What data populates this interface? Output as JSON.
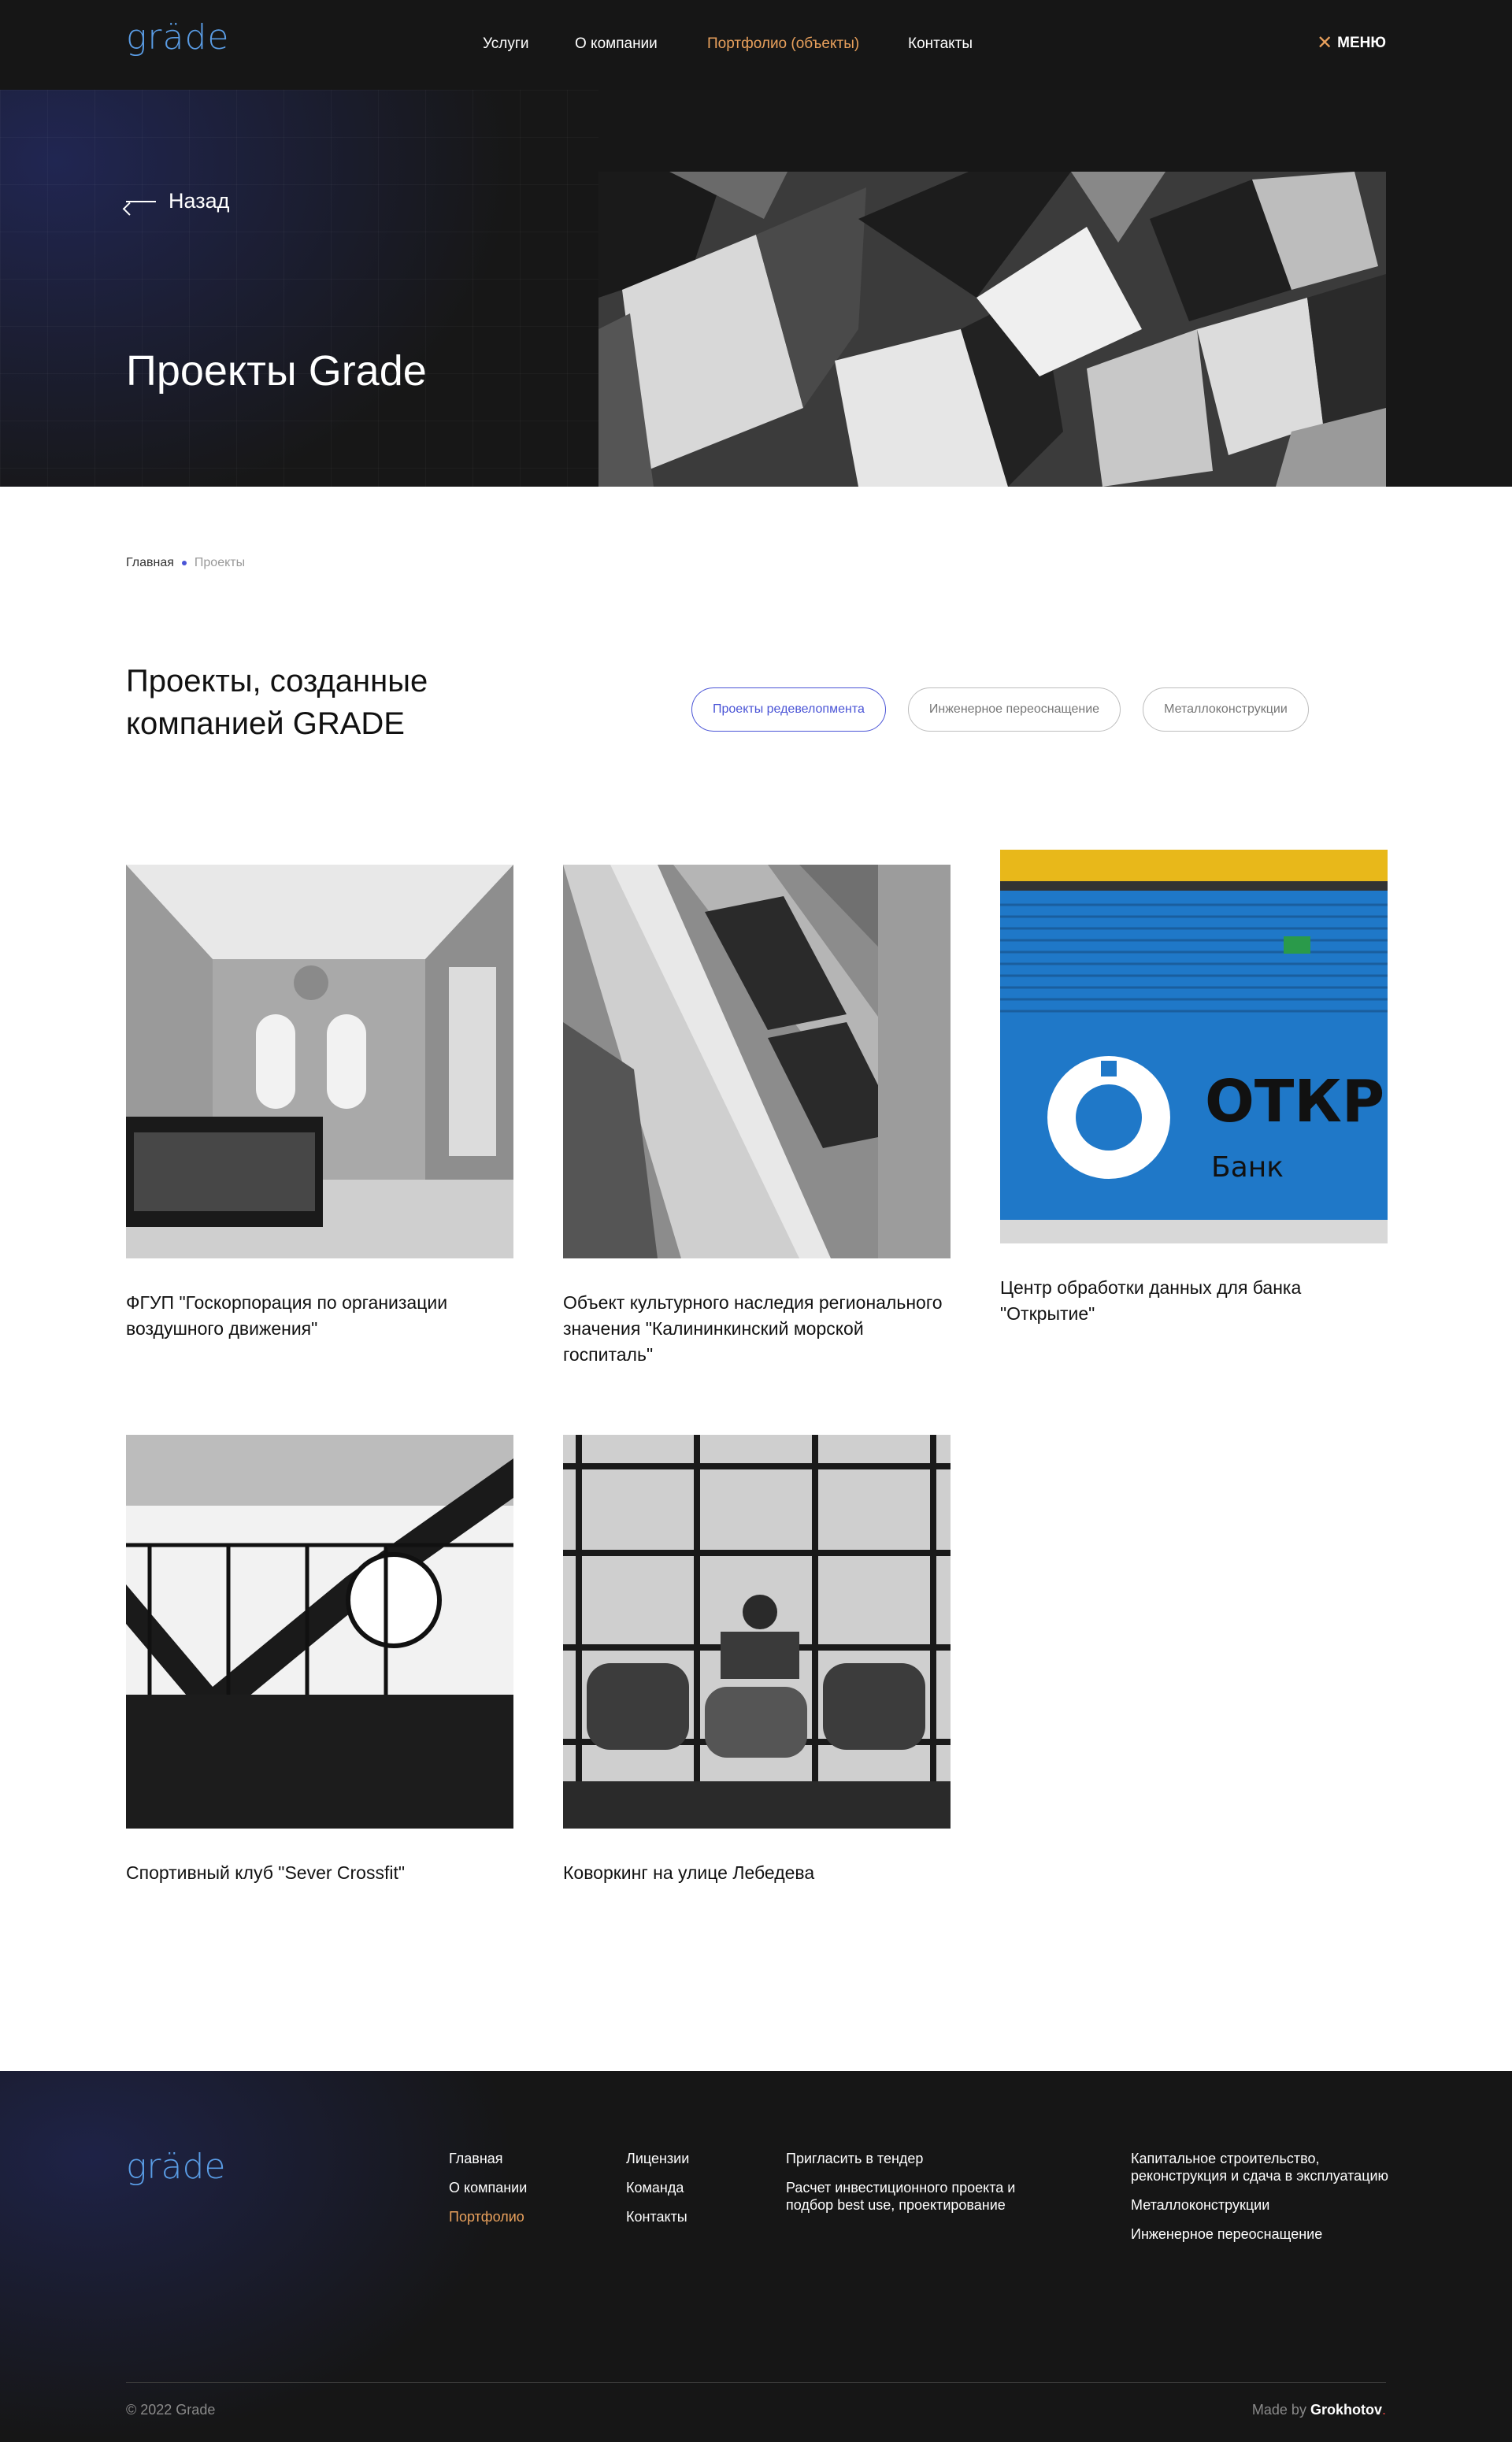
{
  "header": {
    "logo": "gräde",
    "nav": [
      {
        "label": "Услуги"
      },
      {
        "label": "О компании"
      },
      {
        "label": "Портфолио (объекты)",
        "active": true
      },
      {
        "label": "Контакты"
      }
    ],
    "menu_label": "МЕНЮ"
  },
  "hero": {
    "back_label": "Назад",
    "title": "Проекты Grade"
  },
  "breadcrumb": {
    "home": "Главная",
    "current": "Проекты"
  },
  "section": {
    "title": "Проекты, созданные компанией GRADE",
    "filters": [
      {
        "label": "Проекты редевелопмента",
        "active": true
      },
      {
        "label": "Инженерное переоснащение"
      },
      {
        "label": "Металлоконструкции"
      }
    ]
  },
  "projects": [
    {
      "title": "ФГУП \"Госкорпорация по организации воздушного движения\""
    },
    {
      "title": "Объект культурного наследия регионального значения \"Калининкинский морской госпиталь\""
    },
    {
      "title": "Центр обработки данных для банка \"Открытие\""
    },
    {
      "title": "Спортивный клуб \"Sever Crossfit\""
    },
    {
      "title": "Коворкинг на улице Лебедева"
    }
  ],
  "bank_sign": {
    "text": "ОТКРЫТ",
    "sub": "Банк"
  },
  "footer": {
    "logo": "gräde",
    "col1": [
      "Главная",
      "О компании",
      "Портфолио"
    ],
    "col2": [
      "Лицензии",
      "Команда",
      "Контакты"
    ],
    "col3": [
      "Пригласить в тендер",
      "Расчет инвестиционного проекта и подбор best use, проектирование"
    ],
    "col4": [
      "Капитальное строительство, реконструкция и сдача в эксплуатацию",
      "Металлоконструкции",
      "Инженерное переоснащение"
    ],
    "copyright": "© 2022 Grade",
    "made_by_prefix": "Made by",
    "made_by_name": "Grokhotov"
  },
  "colors": {
    "accent_orange": "#e8a05c",
    "accent_blue": "#4a54d6",
    "logo_blue": "#5a9de6",
    "dark_bg": "#161616"
  }
}
